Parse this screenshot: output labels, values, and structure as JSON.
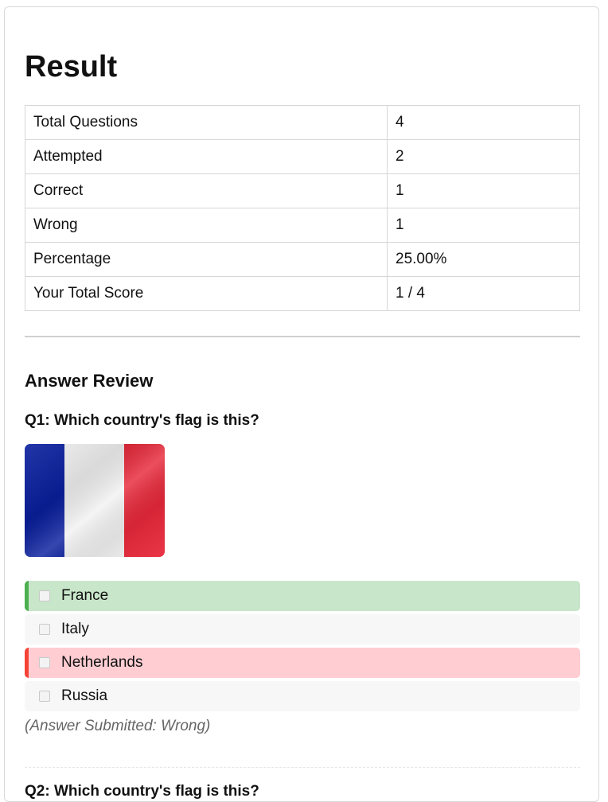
{
  "result": {
    "title": "Result",
    "rows": [
      {
        "label": "Total Questions",
        "value": "4"
      },
      {
        "label": "Attempted",
        "value": "2"
      },
      {
        "label": "Correct",
        "value": "1"
      },
      {
        "label": "Wrong",
        "value": "1"
      },
      {
        "label": "Percentage",
        "value": "25.00%"
      },
      {
        "label": "Your Total Score",
        "value": "1 / 4"
      }
    ]
  },
  "review": {
    "title": "Answer Review",
    "questions": [
      {
        "text": "Q1: Which country's flag is this?",
        "flag_icon": "france-flag-image",
        "flag_colors": [
          "#0a1f9e",
          "#f2f2f2",
          "#e8283a"
        ],
        "options": [
          {
            "label": "France",
            "state": "correct"
          },
          {
            "label": "Italy",
            "state": "neutral"
          },
          {
            "label": "Netherlands",
            "state": "wrong"
          },
          {
            "label": "Russia",
            "state": "neutral"
          }
        ],
        "status": "(Answer Submitted: Wrong)"
      },
      {
        "text": "Q2: Which country's flag is this?"
      }
    ]
  },
  "colors": {
    "correct_bg": "#c8e6c9",
    "correct_accent": "#4caf50",
    "wrong_bg": "#ffcdd2",
    "wrong_accent": "#f44336"
  }
}
